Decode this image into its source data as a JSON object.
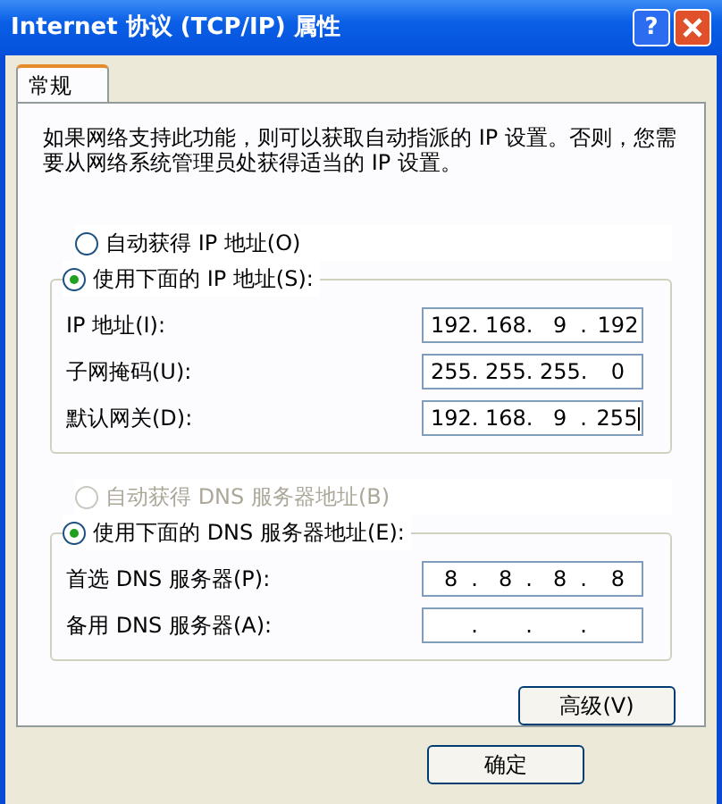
{
  "window": {
    "title": "Internet 协议 (TCP/IP) 属性",
    "help": "?"
  },
  "tabs": [
    {
      "label": "常规",
      "selected": true
    }
  ],
  "description": "如果网络支持此功能，则可以获取自动指派的 IP 设置。否则，您需要从网络系统管理员处获得适当的 IP 设置。",
  "ip_mode": [
    {
      "label": "自动获得 IP 地址(O)",
      "selected": false,
      "disabled": false
    },
    {
      "label": "使用下面的 IP 地址(S):",
      "selected": true,
      "disabled": false
    }
  ],
  "ip_fields": [
    {
      "label": "IP 地址(I):",
      "octets": [
        "192",
        "168",
        "9",
        "192"
      ],
      "dots": [
        ".",
        ".",
        "."
      ],
      "cursor": false
    },
    {
      "label": "子网掩码(U):",
      "octets": [
        "255",
        "255",
        "255",
        "0"
      ],
      "dots": [
        ".",
        ".",
        "."
      ],
      "cursor": false
    },
    {
      "label": "默认网关(D):",
      "octets": [
        "192",
        "168",
        "9",
        "255"
      ],
      "dots": [
        ".",
        ".",
        "."
      ],
      "cursor": true
    }
  ],
  "dns_mode": [
    {
      "label": "自动获得 DNS 服务器地址(B)",
      "selected": false,
      "disabled": true
    },
    {
      "label": "使用下面的 DNS 服务器地址(E):",
      "selected": true,
      "disabled": false
    }
  ],
  "dns_fields": [
    {
      "label": "首选 DNS 服务器(P):",
      "octets": [
        "8",
        "8",
        "8",
        "8"
      ],
      "dots": [
        ".",
        ".",
        "."
      ],
      "cursor": false
    },
    {
      "label": "备用 DNS 服务器(A):",
      "dots": [
        ".",
        ".",
        "."
      ],
      "cursor": false
    }
  ],
  "advanced_button": "高级(V)",
  "ok_button": "确定"
}
